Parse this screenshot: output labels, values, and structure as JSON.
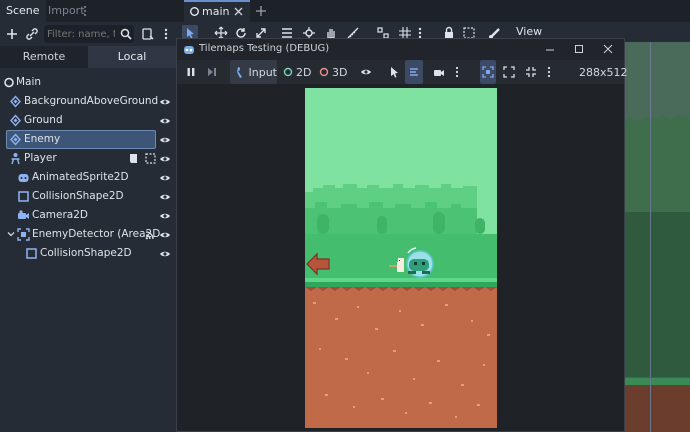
{
  "dock": {
    "tabs": [
      "Scene",
      "Import"
    ],
    "filter_placeholder": "Filter: name, t:t",
    "remote_label": "Remote",
    "local_label": "Local",
    "nodes": [
      {
        "label": "Main"
      },
      {
        "label": "BackgroundAboveGround"
      },
      {
        "label": "Ground"
      },
      {
        "label": "Enemy"
      },
      {
        "label": "Player"
      },
      {
        "label": "AnimatedSprite2D"
      },
      {
        "label": "CollisionShape2D"
      },
      {
        "label": "Camera2D"
      },
      {
        "label": "EnemyDetector (Area2D"
      },
      {
        "label": "CollisionShape2D"
      }
    ]
  },
  "editor": {
    "tab_label": "main",
    "view_label": "View"
  },
  "debug_window": {
    "title": "Tilemaps Testing (DEBUG)",
    "input_label": "Input",
    "label_2d": "2D",
    "label_3d": "3D",
    "resolution": "288x512"
  },
  "colors": {
    "accent": "#6a8fd0",
    "selection": "#3d5577",
    "sky": "#7fe2a0",
    "dirt": "#c06a4a",
    "grass": "#3fb56a"
  }
}
